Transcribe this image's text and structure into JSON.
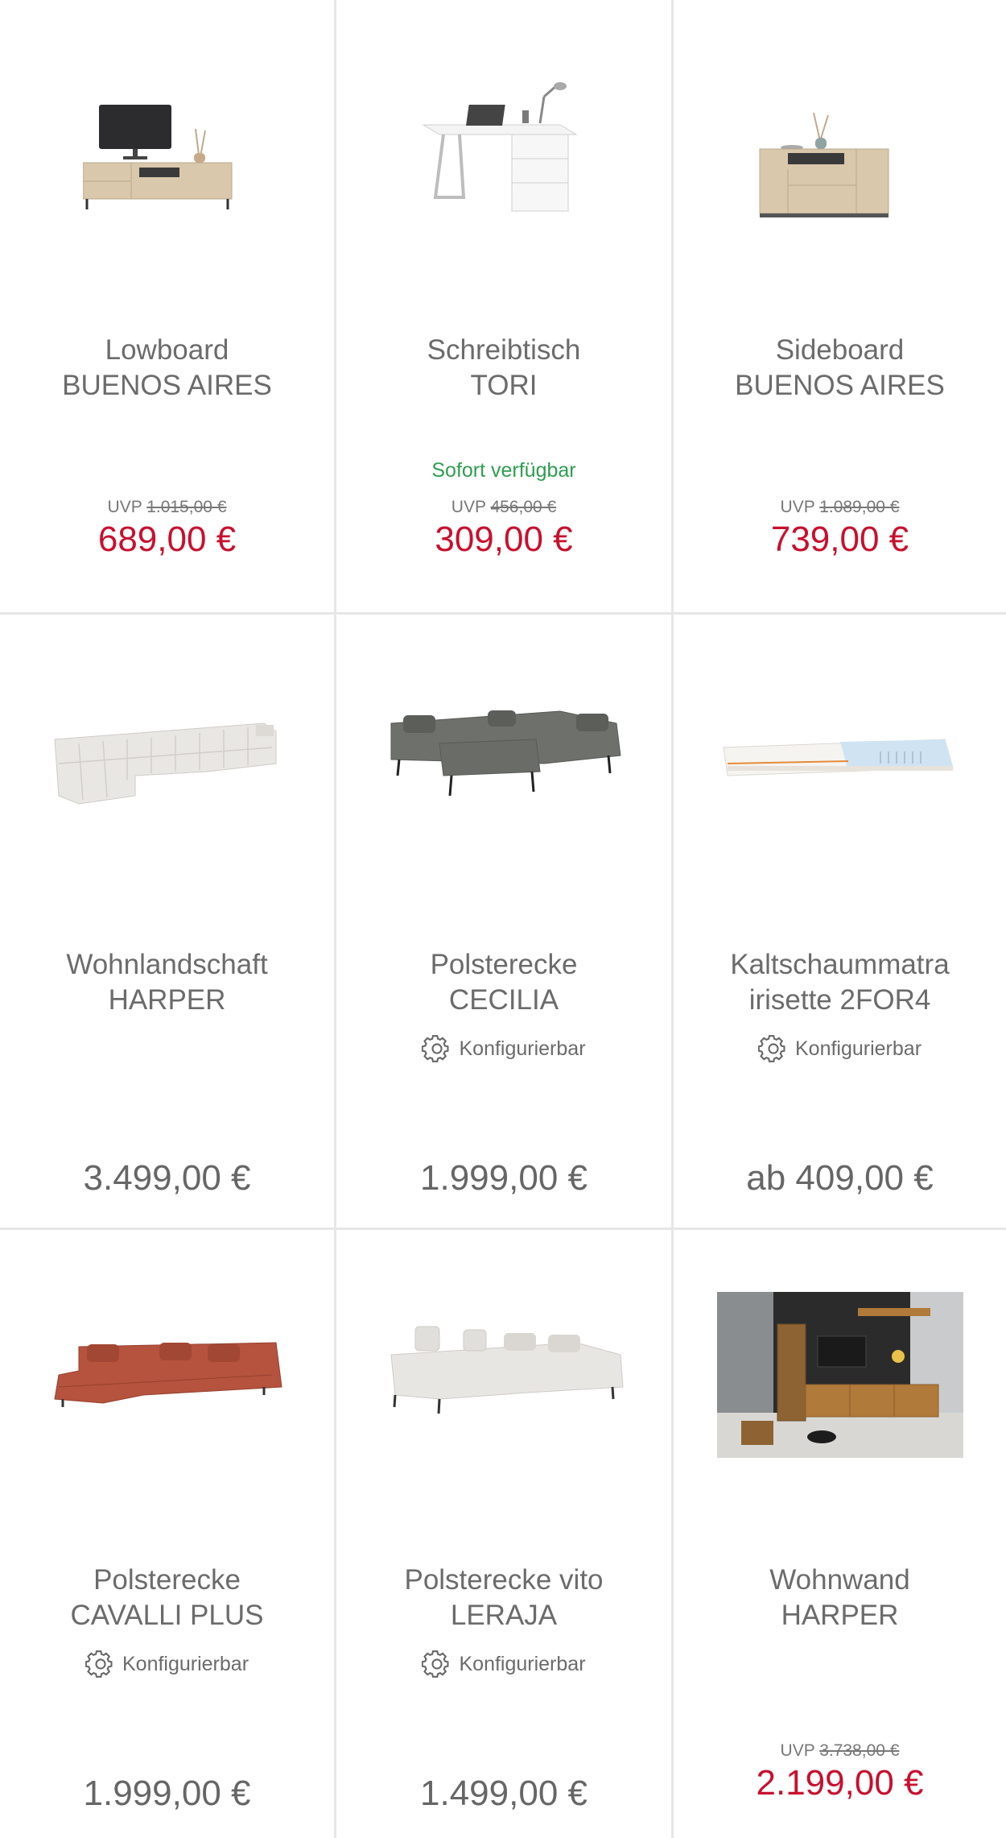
{
  "products": [
    {
      "line1": "Lowboard",
      "line2": "BUENOS AIRES",
      "availability": "",
      "configurable": "",
      "uvp_label": "UVP",
      "uvp_price": "1.015,00 €",
      "price": "689,00 €"
    },
    {
      "line1": "Schreibtisch",
      "line2": "TORI",
      "availability": "Sofort verfügbar",
      "configurable": "",
      "uvp_label": "UVP",
      "uvp_price": "456,00 €",
      "price": "309,00 €"
    },
    {
      "line1": "Sideboard",
      "line2": "BUENOS AIRES",
      "availability": "",
      "configurable": "",
      "uvp_label": "UVP",
      "uvp_price": "1.089,00 €",
      "price": "739,00 €"
    },
    {
      "line1": "Wohnlandschaft",
      "line2": "HARPER",
      "availability": "",
      "configurable": "",
      "uvp_label": "",
      "uvp_price": "",
      "price": "3.499,00 €"
    },
    {
      "line1": "Polsterecke",
      "line2": "CECILIA",
      "availability": "",
      "configurable": "Konfigurierbar",
      "uvp_label": "",
      "uvp_price": "",
      "price": "1.999,00 €"
    },
    {
      "line1": "Kaltschaummatra",
      "line2": "irisette 2FOR4",
      "availability": "",
      "configurable": "Konfigurierbar",
      "uvp_label": "",
      "uvp_price": "",
      "price": "ab 409,00 €"
    },
    {
      "line1": "Polsterecke",
      "line2": "CAVALLI PLUS",
      "availability": "",
      "configurable": "Konfigurierbar",
      "uvp_label": "",
      "uvp_price": "",
      "price": "1.999,00 €"
    },
    {
      "line1": "Polsterecke vito",
      "line2": "LERAJA",
      "availability": "",
      "configurable": "Konfigurierbar",
      "uvp_label": "",
      "uvp_price": "",
      "price": "1.499,00 €"
    },
    {
      "line1": "Wohnwand",
      "line2": "HARPER",
      "availability": "",
      "configurable": "",
      "uvp_label": "UVP",
      "uvp_price": "3.738,00 €",
      "price": "2.199,00 €"
    }
  ],
  "colors": {
    "sale": "#c8102e",
    "available": "#2e9e4f",
    "divider": "#e6e6e6"
  }
}
